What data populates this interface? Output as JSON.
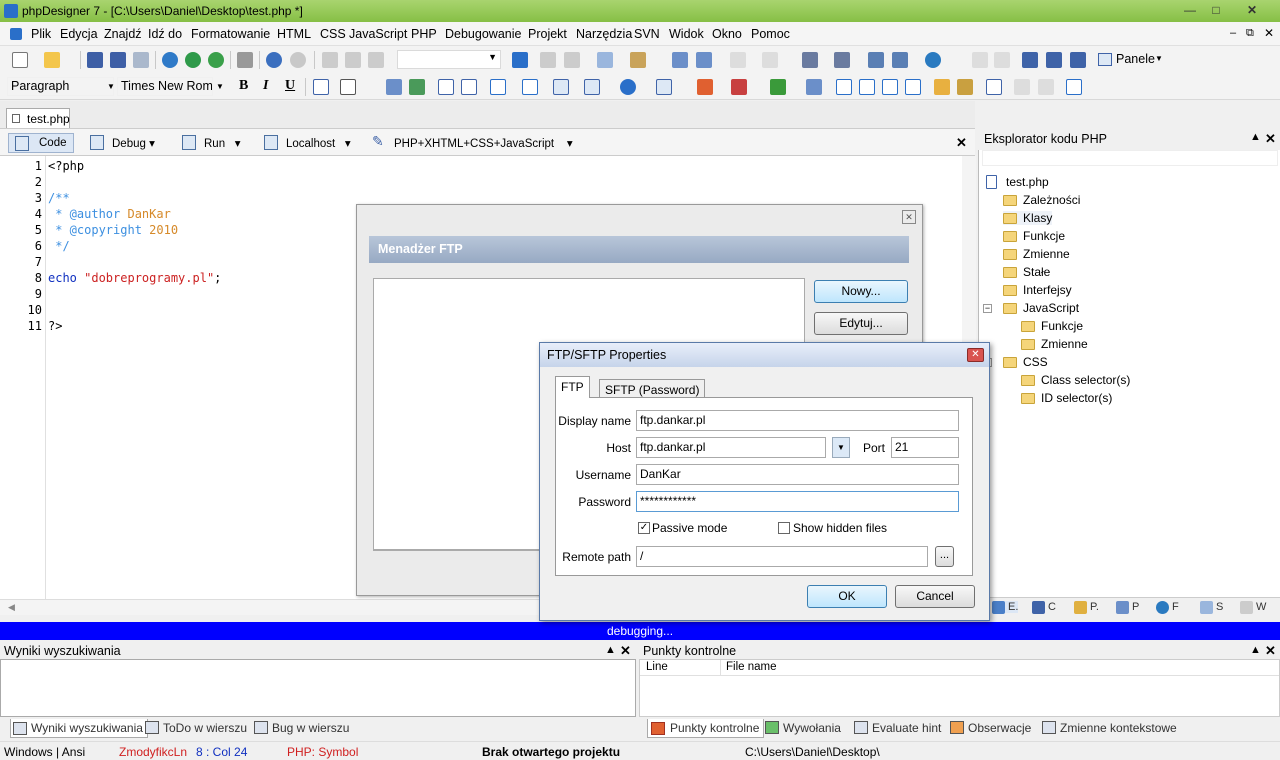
{
  "window": {
    "title": "phpDesigner 7 - [C:\\Users\\Daniel\\Desktop\\test.php *]"
  },
  "menu": [
    "Plik",
    "Edycja",
    "Znajdź",
    "Idź do",
    "Formatowanie",
    "HTML",
    "CSS",
    "JavaScript",
    "PHP",
    "Debugowanie",
    "Projekt",
    "Narzędzia",
    "SVN",
    "Widok",
    "Okno",
    "Pomoc"
  ],
  "toolbar": {
    "paragraph": "Paragraph",
    "font": "Times New Roma",
    "bold": "B",
    "italic": "I",
    "underline": "U",
    "panele": "Panele"
  },
  "tab": {
    "file": "test.php"
  },
  "editor_toolbar": {
    "code": "Code",
    "debug": "Debug",
    "run": "Run",
    "localhost": "Localhost",
    "syntax": "PHP+XHTML+CSS+JavaScript"
  },
  "code_lines": [
    {
      "n": "1",
      "text": "<?php"
    },
    {
      "n": "2",
      "text": ""
    },
    {
      "n": "3",
      "text": "/**"
    },
    {
      "n": "4",
      "text": " * @author DanKar"
    },
    {
      "n": "5",
      "text": " * @copyright 2010"
    },
    {
      "n": "6",
      "text": " */"
    },
    {
      "n": "7",
      "text": ""
    },
    {
      "n": "8",
      "text": "echo \"dobreprogramy.pl\";"
    },
    {
      "n": "9",
      "text": ""
    },
    {
      "n": "10",
      "text": ""
    },
    {
      "n": "11",
      "text": "?>"
    }
  ],
  "code_colors": {
    "comment": "#3c8fe0",
    "author": "#d68a2a",
    "string": "#cc2222",
    "keyword": "#1030c0"
  },
  "explorer": {
    "title": "Eksplorator kodu PHP",
    "root": "test.php",
    "items": [
      "Zależności",
      "Klasy",
      "Funkcje",
      "Zmienne",
      "Stałe",
      "Interfejsy",
      "JavaScript",
      "Funkcje",
      "Zmienne",
      "CSS",
      "Class selector(s)",
      "ID selector(s)"
    ],
    "tabs": [
      "E.",
      "C",
      "P.",
      "P",
      "F",
      "S",
      "W"
    ]
  },
  "debug_bar": "debugging...",
  "search_panel": {
    "title": "Wyniki wyszukiwania",
    "tabs": [
      "Wyniki wyszukiwania",
      "ToDo w wierszu",
      "Bug w wierszu"
    ]
  },
  "breakpoints_panel": {
    "title": "Punkty kontrolne",
    "columns": [
      "Line",
      "File name"
    ],
    "tabs": [
      "Punkty kontrolne",
      "Wywołania",
      "Evaluate hint",
      "Obserwacje",
      "Zmienne kontekstowe"
    ]
  },
  "status": {
    "encoding": "Windows | Ansi",
    "modified": "ZmodyfikcLn",
    "position": "8 : Col  24",
    "symbol": "PHP: Symbol",
    "project": "Brak otwartego projektu",
    "path": "C:\\Users\\Daniel\\Desktop\\"
  },
  "ftp_manager": {
    "title": "Menadżer FTP",
    "new_label": "Nowy...",
    "edit_label": "Edytuj..."
  },
  "ftp_props": {
    "title": "FTP/SFTP Properties",
    "tab_ftp": "FTP",
    "tab_sftp": "SFTP (Password)",
    "display_name_label": "Display name",
    "display_name": "ftp.dankar.pl",
    "host_label": "Host",
    "host": "ftp.dankar.pl",
    "port_label": "Port",
    "port": "21",
    "username_label": "Username",
    "username": "DanKar",
    "password_label": "Password",
    "password": "************",
    "passive_label": "Passive mode",
    "passive_checked": true,
    "hidden_label": "Show hidden files",
    "hidden_checked": false,
    "remote_label": "Remote path",
    "remote_path": "/",
    "browse_label": "...",
    "ok_label": "OK",
    "cancel_label": "Cancel"
  }
}
